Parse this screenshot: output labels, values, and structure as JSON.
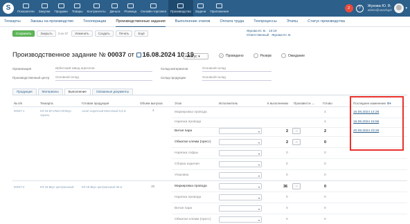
{
  "nav": {
    "logo": "S",
    "items": [
      {
        "label": "Показатели",
        "icon": "chart-icon"
      },
      {
        "label": "Закупки",
        "icon": "cart-icon"
      },
      {
        "label": "Продажи",
        "icon": "sales-icon"
      },
      {
        "label": "Товары",
        "icon": "goods-icon"
      },
      {
        "label": "Контрагенты",
        "icon": "contacts-icon"
      },
      {
        "label": "Деньги",
        "icon": "money-icon"
      },
      {
        "label": "Розница",
        "icon": "retail-icon"
      },
      {
        "label": "Онлайн-торговля",
        "icon": "online-icon"
      },
      {
        "label": "Производство",
        "icon": "factory-icon",
        "active": true
      },
      {
        "label": "Задачи",
        "icon": "tasks-icon"
      },
      {
        "label": "Приложения",
        "icon": "apps-icon"
      }
    ],
    "notif_count": "2",
    "user_name": "Жукова Ю. В.",
    "user_email": "admin@usachgol"
  },
  "tabs": [
    "Техкарты",
    "Заказы на производство",
    "Техоперации",
    "Производственные задания",
    "Выполнение этапов",
    "Оплата труда",
    "Техпроцессы",
    "Этапы",
    "Статус производства"
  ],
  "active_tab": "Производственные задания",
  "toolbar": {
    "save": "Сохранить",
    "close": "Закрыть",
    "counter": "3 из 37",
    "edit": "Изменить",
    "create": "Создать",
    "print": "Печать",
    "more": "Ещё"
  },
  "meta": {
    "line1": "Жукова Ю. В. · 10:19",
    "line2": "Ответственный · Жукова Ю. В."
  },
  "header": {
    "prefix": "Производственное задание №",
    "number": "00037",
    "from": "от",
    "date": "16.08.2024 10:19",
    "status_label": "Статус",
    "radios": [
      "Проведено",
      "Резерв",
      "Ожидание"
    ]
  },
  "fields": {
    "org_label": "Организация",
    "org_value": "Ирбитский завод агрегатов",
    "center_label": "Производственный центр",
    "center_value": "Основной склад",
    "mat_label": "Склад материалов",
    "mat_value": "Основной склад",
    "prod_label": "Склад продукции",
    "prod_value": "Основной склад"
  },
  "subtabs": [
    "Продукция",
    "Материалы",
    "Выполнение",
    "Связанные документы"
  ],
  "active_subtab": "Выполнение",
  "columns": {
    "num": "№ п/п",
    "techcard": "Техкарта",
    "product": "Готовая продукция",
    "volume": "Объём выпуска",
    "stage": "Этап",
    "executor": "Исполнитель",
    "todo": "К выполнению",
    "produce": "Произвести",
    "ready": "Готово",
    "last_change": "Последнее изменение"
  },
  "groups": [
    {
      "num": "00037-1",
      "techcard": "КЛ-18-ЕГАЛ&Н-30-Вкус сирень",
      "product": "салат аэрочный Молочный 0,8 кг",
      "volume": "4"
    },
    {
      "num": "00037-2",
      "techcard": "КЛ-18-Вкус центральный",
      "product": "КЛ-18-Вкус центральный 36 кг",
      "volume": "36"
    }
  ],
  "rows": [
    {
      "stage": "Маркировка провода",
      "todo": "",
      "done": "4",
      "change": "16.08.2024 14:26",
      "has_sel": false
    },
    {
      "stage": "Нарезка провода",
      "todo": "",
      "done": "4",
      "change": "16.08.2024 15:56",
      "has_sel": false
    },
    {
      "stage": "Витая пара",
      "todo": "2",
      "done": "2",
      "change": "20.08.2024 23:26",
      "has_sel": true,
      "has_arrow": true
    },
    {
      "stage": "Обжатие клемм (пресс)",
      "todo": "2",
      "done": "0",
      "change": "",
      "has_sel": true,
      "has_arrow": true
    },
    {
      "stage": "Нарезка гофры",
      "todo": "0",
      "done": "0",
      "change": "",
      "has_sel": true
    },
    {
      "stage": "Сборка изделия",
      "todo": "0",
      "done": "0",
      "change": "",
      "has_sel": true
    },
    {
      "stage": "Упаковка",
      "todo": "0",
      "done": "0",
      "change": "",
      "has_sel": true
    },
    {
      "stage": "Маркировка провода",
      "todo": "36",
      "done": "0",
      "change": "",
      "has_sel": true,
      "has_arrow": true
    },
    {
      "stage": "Нарезка провода",
      "todo": "0",
      "done": "0",
      "change": "",
      "has_sel": true
    },
    {
      "stage": "Витая пара",
      "todo": "0",
      "done": "0",
      "change": "",
      "has_sel": true
    },
    {
      "stage": "Обжатие клемм (пресс)",
      "todo": "0",
      "done": "0",
      "change": "",
      "has_sel": true
    }
  ],
  "arrow_symbol": "→"
}
